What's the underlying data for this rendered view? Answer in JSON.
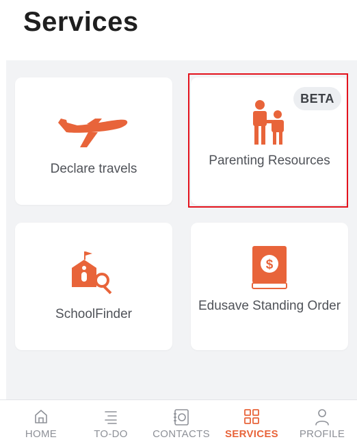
{
  "page": {
    "title": "Services"
  },
  "colors": {
    "accent": "#e8643a",
    "highlight_border": "#e3111b",
    "background": "#f2f3f5",
    "card": "#ffffff",
    "nav_inactive": "#8d9097"
  },
  "services": {
    "cards": [
      {
        "id": "declare-travels",
        "label": "Declare travels",
        "icon": "airplane-icon"
      },
      {
        "id": "parenting-resources",
        "label": "Parenting Resources",
        "icon": "parent-child-icon",
        "badge": "BETA",
        "highlighted": true
      },
      {
        "id": "schoolfinder",
        "label": "SchoolFinder",
        "icon": "school-search-icon"
      },
      {
        "id": "edusave-standing-order",
        "label": "Edusave Standing Order",
        "icon": "edusave-book-icon"
      }
    ]
  },
  "nav": {
    "items": [
      {
        "label": "HOME",
        "icon": "home-icon",
        "active": false
      },
      {
        "label": "TO-DO",
        "icon": "list-icon",
        "active": false
      },
      {
        "label": "CONTACTS",
        "icon": "contacts-icon",
        "active": false
      },
      {
        "label": "SERVICES",
        "icon": "grid-icon",
        "active": true
      },
      {
        "label": "PROFILE",
        "icon": "profile-icon",
        "active": false
      }
    ]
  }
}
